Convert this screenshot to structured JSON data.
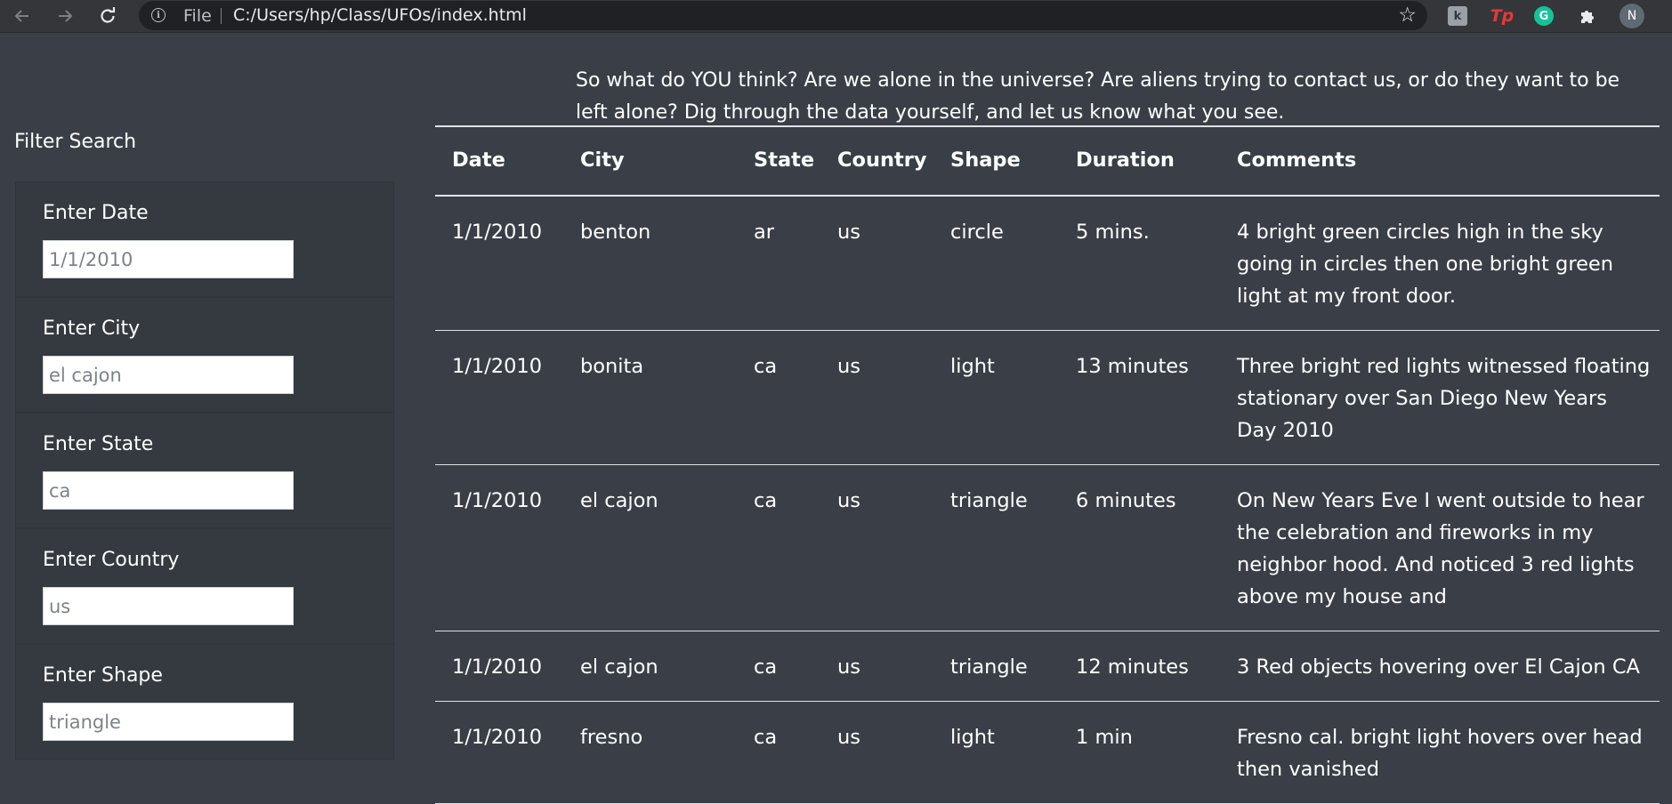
{
  "browser": {
    "url_scheme": "File",
    "url": "C:/Users/hp/Class/UFOs/index.html",
    "avatar_initial": "N",
    "ext_k": "k",
    "ext_tp": "Tp",
    "ext_g": "G"
  },
  "intro": "So what do YOU think? Are we alone in the universe? Are aliens trying to contact us, or do they want to be left alone? Dig through the data yourself, and let us know what you see.",
  "filters": {
    "title": "Filter Search",
    "items": [
      {
        "label": "Enter Date",
        "placeholder": "1/1/2010"
      },
      {
        "label": "Enter City",
        "placeholder": "el cajon"
      },
      {
        "label": "Enter State",
        "placeholder": "ca"
      },
      {
        "label": "Enter Country",
        "placeholder": "us"
      },
      {
        "label": "Enter Shape",
        "placeholder": "triangle"
      }
    ]
  },
  "table": {
    "headers": [
      "Date",
      "City",
      "State",
      "Country",
      "Shape",
      "Duration",
      "Comments"
    ],
    "rows": [
      [
        "1/1/2010",
        "benton",
        "ar",
        "us",
        "circle",
        "5 mins.",
        "4 bright green circles high in the sky going in circles then one bright green light at my front door."
      ],
      [
        "1/1/2010",
        "bonita",
        "ca",
        "us",
        "light",
        "13 minutes",
        "Three bright red lights witnessed floating stationary over San Diego New Years Day 2010"
      ],
      [
        "1/1/2010",
        "el cajon",
        "ca",
        "us",
        "triangle",
        "6 minutes",
        "On New Years Eve I went outside to hear the celebration and fireworks in my neighbor hood. And noticed 3 red lights above my house and"
      ],
      [
        "1/1/2010",
        "el cajon",
        "ca",
        "us",
        "triangle",
        "12 minutes",
        "3 Red objects hovering over El Cajon CA"
      ],
      [
        "1/1/2010",
        "fresno",
        "ca",
        "us",
        "light",
        "1 min",
        "Fresno cal. bright light hovers over head then vanished"
      ]
    ]
  }
}
